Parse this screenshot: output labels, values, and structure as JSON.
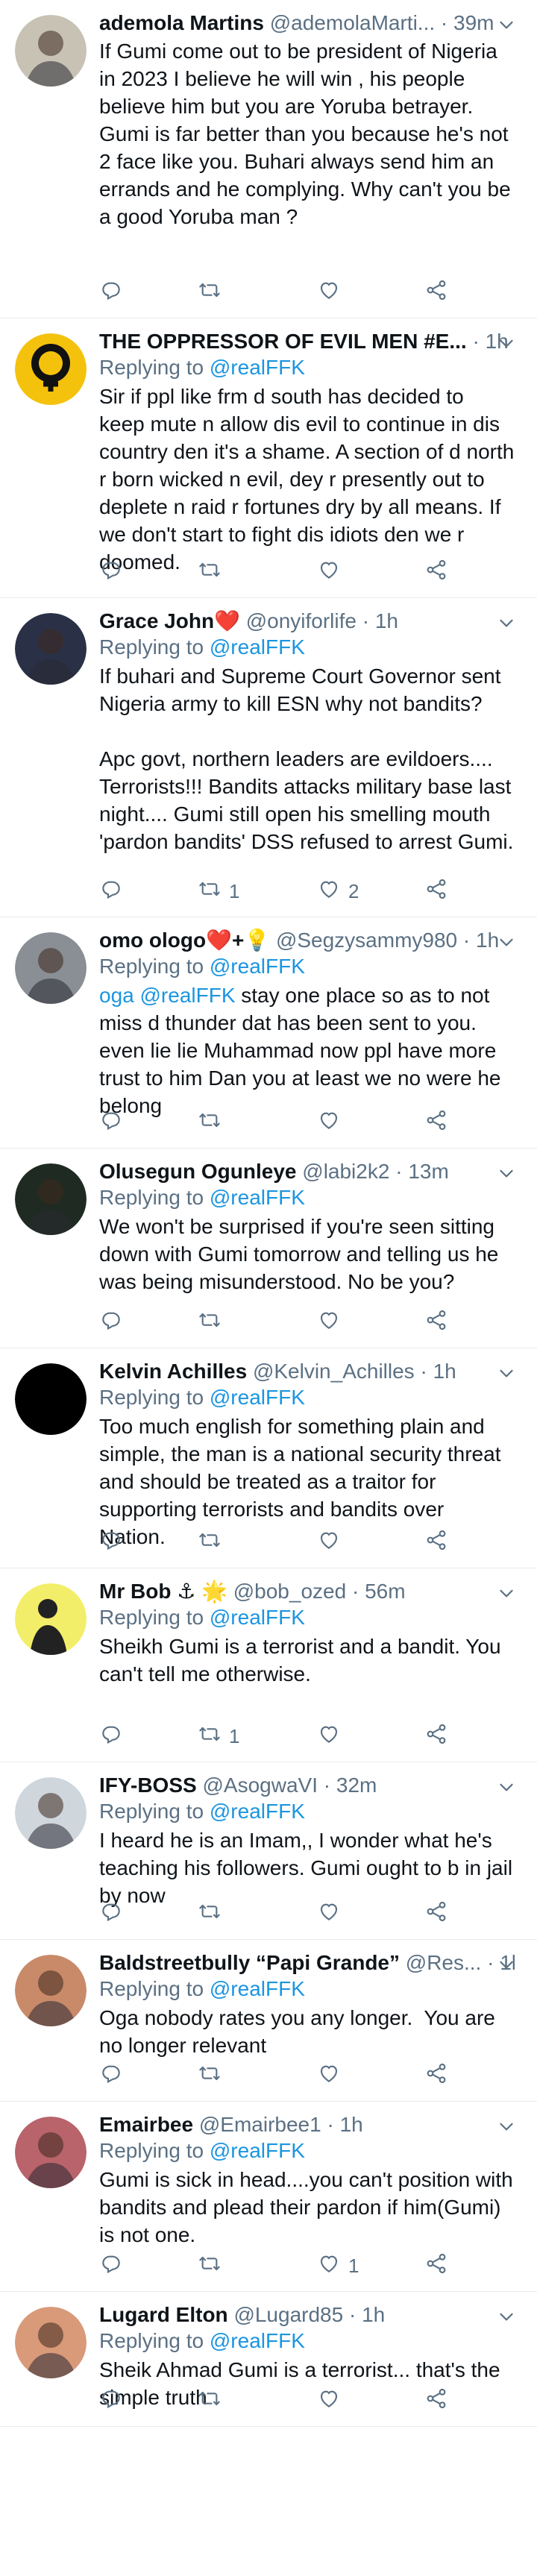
{
  "tweets": [
    {
      "name": "ademola Martins",
      "handle": "@ademolaMarti...",
      "time": "39m",
      "show_replying": false,
      "text": "If Gumi come out to be president of Nigeria in 2023 I believe he will win , his people believe him but you are Yoruba betrayer. Gumi is far better than you because he's not 2 face like you. Buhari always send him an errands and he complying. Why can't you be a good Yoruba man ?",
      "retweets": "",
      "likes": "",
      "avatar_bg": "#c8c2b5"
    },
    {
      "name": "THE OPPRESSOR OF EVIL MEN #E...",
      "handle": "",
      "time": "1h",
      "show_replying": true,
      "text": "Sir if ppl like frm d south has decided to keep mute n allow dis evil to continue in dis country den it's a shame. A section of d north r born wicked n evil, dey r presently out to deplete n raid r fortunes dry by all means. If we don't start to fight dis idiots den we r doomed.",
      "retweets": "",
      "likes": "",
      "avatar_bg": "#f4c20d"
    },
    {
      "name": "Grace John❤️",
      "handle": "@onyiforlife",
      "time": "1h",
      "show_replying": true,
      "text": "If buhari and Supreme Court Governor sent Nigeria army to kill ESN why not bandits?\n\nApc govt, northern leaders are evildoers.... Terrorists!!! Bandits attacks military base last night.... Gumi still open his smelling mouth 'pardon bandits' DSS refused to arrest Gumi.",
      "retweets": "1",
      "likes": "2",
      "avatar_bg": "#2a3147"
    },
    {
      "name": "omo ologo❤️+💡",
      "handle": "@Segzysammy980",
      "time": "1h",
      "show_replying": true,
      "text_mention": "oga @realFFK",
      "text": " stay one place so as to not miss d thunder dat has been sent to you. even lie lie Muhammad now ppl have more trust to him Dan you at least we no were he belong",
      "retweets": "",
      "likes": "",
      "avatar_bg": "#8a8f95"
    },
    {
      "name": "Olusegun Ogunleye",
      "handle": "@labi2k2",
      "time": "13m",
      "show_replying": true,
      "text": "We won't be surprised if you're seen sitting down with Gumi tomorrow and telling us he was being misunderstood. No be you?",
      "retweets": "",
      "likes": "",
      "avatar_bg": "#1f2a22"
    },
    {
      "name": "Kelvin Achilles",
      "handle": "@Kelvin_Achilles",
      "time": "1h",
      "show_replying": true,
      "text": "Too much english for something plain and simple, the man is a national security threat and should be treated as a traitor for supporting terrorists and bandits over Nation.",
      "retweets": "",
      "likes": "",
      "avatar_bg": "#000000"
    },
    {
      "name": "Mr Bob ⚓ 🌟",
      "handle": "@bob_ozed",
      "time": "56m",
      "show_replying": true,
      "text": "Sheikh Gumi is a terrorist and a bandit. You can't tell me otherwise.",
      "retweets": "1",
      "likes": "",
      "avatar_bg": "#f3ee6a"
    },
    {
      "name": "IFY-BOSS",
      "handle": "@AsogwaVI",
      "time": "32m",
      "show_replying": true,
      "text": "I heard he is an Imam,, I wonder what he's teaching his followers. Gumi ought to b in jail by now",
      "retweets": "",
      "likes": "",
      "avatar_bg": "#cfd6dc"
    },
    {
      "name": "Baldstreetbully “Papi Grande”",
      "handle": "@Res...",
      "time": "1h",
      "show_replying": true,
      "text": "Oga nobody rates you any longer.  You are no longer relevant",
      "retweets": "",
      "likes": "",
      "avatar_bg": "#c98a6a"
    },
    {
      "name": "Emairbee",
      "handle": "@Emairbee1",
      "time": "1h",
      "show_replying": true,
      "text": "Gumi is sick in head....you can't position with bandits and plead their pardon if him(Gumi) is not one.",
      "retweets": "",
      "likes": "1",
      "avatar_bg": "#b9636a"
    },
    {
      "name": "Lugard Elton",
      "handle": "@Lugard85",
      "time": "1h",
      "show_replying": true,
      "text": "Sheik Ahmad Gumi is a terrorist... that's the simple truth",
      "retweets": "",
      "likes": "",
      "avatar_bg": "#d99a7a"
    }
  ],
  "replying_prefix": "Replying to ",
  "replying_mention": "@realFFK",
  "separator": " · ",
  "icons": [
    "reply-icon",
    "retweet-icon",
    "like-icon",
    "share-icon",
    "more-icon"
  ],
  "colors": {
    "text": "#0f1419",
    "secondary": "#5b7083",
    "link": "#1b95e0",
    "divider": "#e6ecf0"
  }
}
